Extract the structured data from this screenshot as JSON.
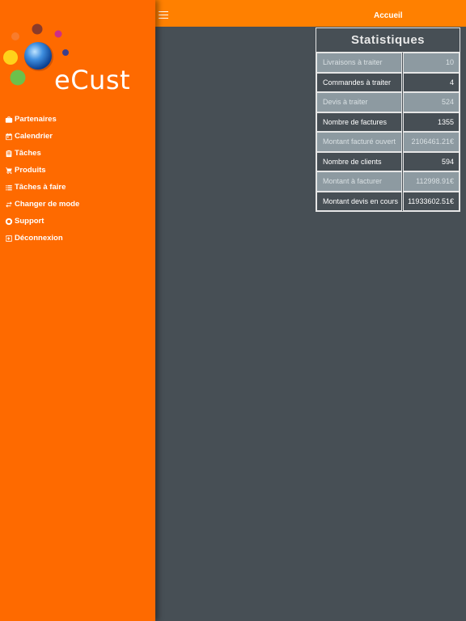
{
  "app": {
    "logo_text": "eCust"
  },
  "header": {
    "title": "Accueil"
  },
  "sidebar": {
    "items": [
      {
        "label": "Partenaires",
        "icon": "briefcase-icon"
      },
      {
        "label": "Calendrier",
        "icon": "calendar-icon"
      },
      {
        "label": "Tâches",
        "icon": "clipboard-icon"
      },
      {
        "label": "Produits",
        "icon": "cart-icon"
      },
      {
        "label": "Tâches à faire",
        "icon": "list-icon"
      },
      {
        "label": "Changer de mode",
        "icon": "swap-icon"
      },
      {
        "label": "Support",
        "icon": "support-icon"
      },
      {
        "label": "Déconnexion",
        "icon": "logout-icon"
      }
    ]
  },
  "stats": {
    "title": "Statistiques",
    "rows": [
      {
        "label": "Livraisons à traiter",
        "value": "10"
      },
      {
        "label": "Commandes à traiter",
        "value": "4"
      },
      {
        "label": "Devis à traiter",
        "value": "524"
      },
      {
        "label": "Nombre de factures",
        "value": "1355"
      },
      {
        "label": "Montant facturé ouvert",
        "value": "2106461.21€"
      },
      {
        "label": "Nombre de clients",
        "value": "594"
      },
      {
        "label": "Montant à facturer",
        "value": "112998.91€"
      },
      {
        "label": "Montant devis en cours",
        "value": "11933602.51€"
      }
    ]
  },
  "colors": {
    "sidebar_bg": "#fe6a00",
    "header_bg": "#ff8000",
    "content_bg": "#474f55",
    "row_light": "#8d9aa1"
  }
}
